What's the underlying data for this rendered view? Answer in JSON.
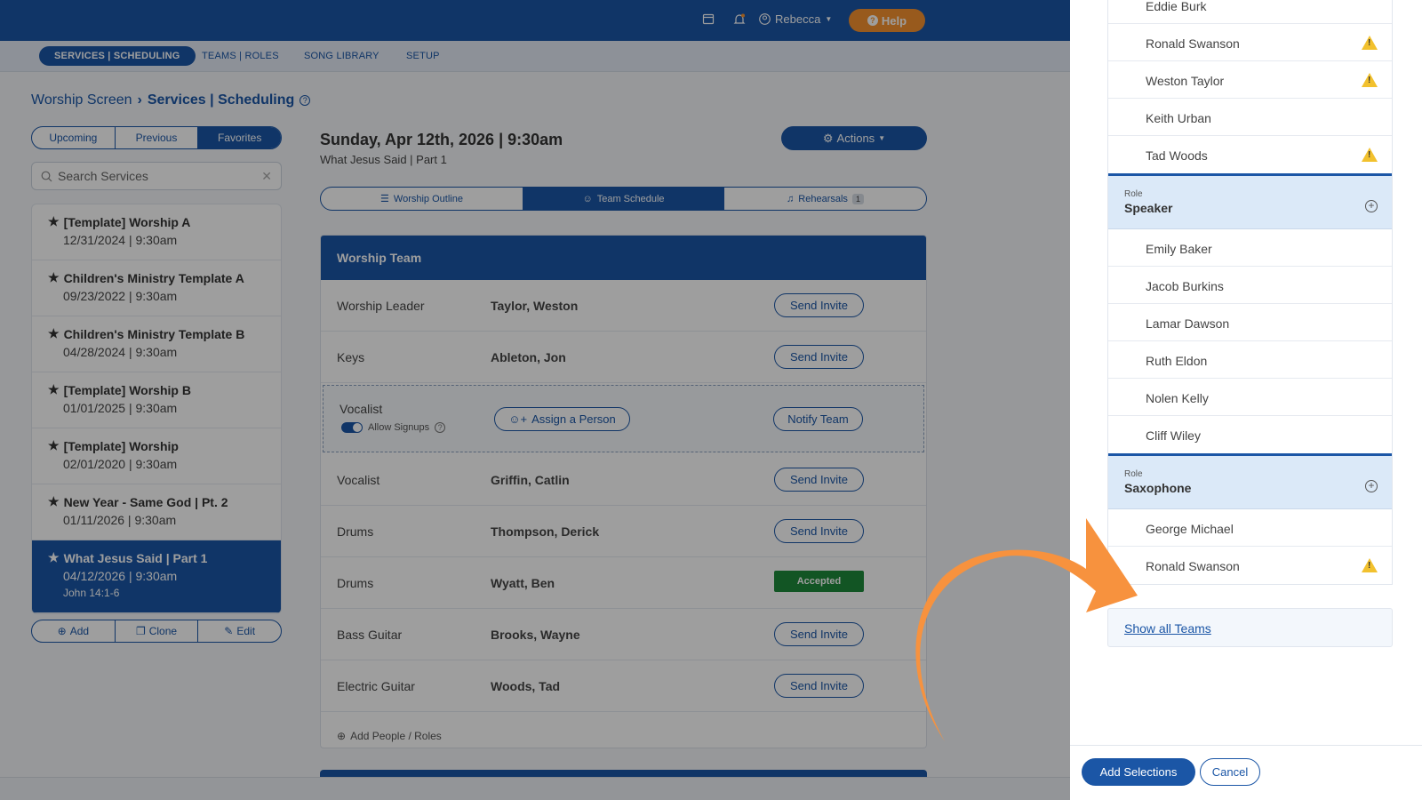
{
  "header": {
    "user_name": "Rebecca",
    "help_label": "Help"
  },
  "subnav": {
    "items": [
      "SERVICES | SCHEDULING",
      "TEAMS | ROLES",
      "SONG LIBRARY",
      "SETUP"
    ]
  },
  "breadcrumb": {
    "root": "Worship Screen",
    "current": "Services | Scheduling"
  },
  "filters": {
    "tabs": [
      "Upcoming",
      "Previous",
      "Favorites"
    ],
    "search_placeholder": "Search Services"
  },
  "services": [
    {
      "title": "[Template] Worship A",
      "date": "12/31/2024 | 9:30am"
    },
    {
      "title": "Children's Ministry Template A",
      "date": "09/23/2022 | 9:30am"
    },
    {
      "title": "Children's Ministry Template B",
      "date": "04/28/2024 | 9:30am"
    },
    {
      "title": "[Template] Worship B",
      "date": "01/01/2025 | 9:30am"
    },
    {
      "title": "[Template] Worship",
      "date": "02/01/2020 | 9:30am"
    },
    {
      "title": "New Year - Same God | Pt. 2",
      "date": "01/11/2026 | 9:30am"
    },
    {
      "title": "What Jesus Said | Part 1",
      "date": "04/12/2026 | 9:30am",
      "passage": "John 14:1-6"
    }
  ],
  "service_actions": {
    "add": "Add",
    "clone": "Clone",
    "edit": "Edit"
  },
  "service": {
    "title": "Sunday, Apr 12th, 2026 | 9:30am",
    "subtitle": "What Jesus Said | Part 1",
    "actions_label": "Actions"
  },
  "view_tabs": {
    "outline": "Worship Outline",
    "schedule": "Team Schedule",
    "rehearsals": "Rehearsals",
    "rehearsals_count": "1"
  },
  "team": {
    "name": "Worship Team",
    "rows": [
      {
        "role": "Worship Leader",
        "person": "Taylor, Weston",
        "action": "Send Invite"
      },
      {
        "role": "Keys",
        "person": "Ableton, Jon",
        "action": "Send Invite"
      },
      {
        "role": "Vocalist",
        "person": "Griffin, Catlin",
        "action": "Send Invite"
      },
      {
        "role": "Drums",
        "person": "Thompson, Derick",
        "action": "Send Invite"
      },
      {
        "role": "Drums",
        "person": "Wyatt, Ben",
        "status": "Accepted"
      },
      {
        "role": "Bass Guitar",
        "person": "Brooks, Wayne",
        "action": "Send Invite"
      },
      {
        "role": "Electric Guitar",
        "person": "Woods, Tad",
        "action": "Send Invite"
      }
    ],
    "open_role": {
      "role": "Vocalist",
      "allow_signups": "Allow Signups",
      "assign_label": "Assign a Person",
      "notify_label": "Notify Team"
    },
    "add_people_label": "Add People / Roles"
  },
  "drawer": {
    "top_people": [
      {
        "name": "Eddie Burk",
        "warning": false
      },
      {
        "name": "Ronald Swanson",
        "warning": true
      },
      {
        "name": "Weston Taylor",
        "warning": true
      },
      {
        "name": "Keith Urban",
        "warning": false
      },
      {
        "name": "Tad Woods",
        "warning": true
      }
    ],
    "role_label": "Role",
    "speaker": {
      "name": "Speaker",
      "people": [
        "Emily Baker",
        "Jacob Burkins",
        "Lamar Dawson",
        "Ruth Eldon",
        "Nolen Kelly",
        "Cliff Wiley"
      ]
    },
    "saxophone": {
      "name": "Saxophone",
      "people": [
        {
          "name": "George Michael",
          "warning": false
        },
        {
          "name": "Ronald Swanson",
          "warning": true
        }
      ]
    },
    "show_all_label": "Show all Teams",
    "add_selections_label": "Add Selections",
    "cancel_label": "Cancel"
  },
  "colors": {
    "brand_blue": "#1b56a6",
    "help_orange": "#f5922f",
    "accepted_green": "#1e8a3a",
    "warning_yellow": "#f2c12e",
    "arrow_orange": "#f7923e"
  }
}
